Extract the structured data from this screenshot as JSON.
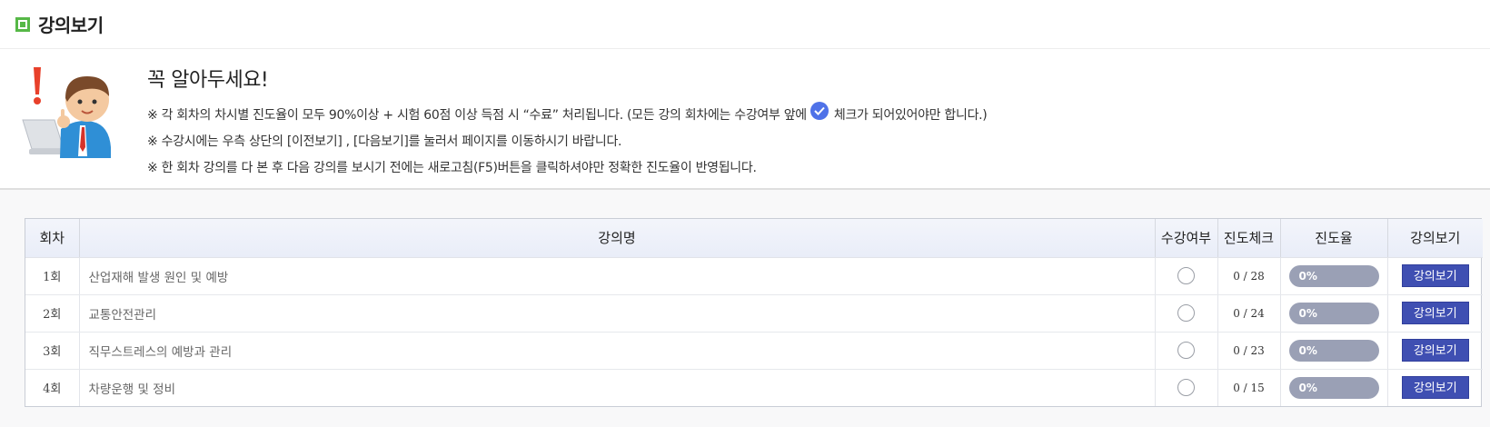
{
  "header": {
    "title": "강의보기",
    "accent_color": "#56b847"
  },
  "notice": {
    "title": "꼭 알아두세요!",
    "line1_before": "※ 각 회차의 차시별 진도율이 모두 90%이상 + 시험 60점 이상 득점 시 “수료” 처리됩니다. (모든 강의 회차에는 수강여부 앞에",
    "line1_after": "체크가 되어있어야만 합니다.)",
    "line2": "※ 수강시에는 우측 상단의 [이전보기] , [다음보기]를 눌러서 페이지를 이동하시기 바랍니다.",
    "line3": "※ 한 회차 강의를 다 본 후 다음 강의를 보시기 전에는 새로고침(F5)버튼을 클릭하셔야만 정확한 진도율이 반영됩니다.",
    "check_icon": "check-circle-icon",
    "check_color": "#4f72e8"
  },
  "table": {
    "headers": {
      "round": "회차",
      "name": "강의명",
      "attend": "수강여부",
      "check": "진도체크",
      "progress": "진도율",
      "view": "강의보기"
    },
    "rows": [
      {
        "round": "1회",
        "name": "산업재해 발생 원인 및 예방",
        "attended": false,
        "check": "0 / 28",
        "progress": 0,
        "progress_label": "0%",
        "button": "강의보기"
      },
      {
        "round": "2회",
        "name": "교통안전관리",
        "attended": false,
        "check": "0 / 24",
        "progress": 0,
        "progress_label": "0%",
        "button": "강의보기"
      },
      {
        "round": "3회",
        "name": "직무스트레스의 예방과 관리",
        "attended": false,
        "check": "0 / 23",
        "progress": 0,
        "progress_label": "0%",
        "button": "강의보기"
      },
      {
        "round": "4회",
        "name": "차량운행 및 정비",
        "attended": false,
        "check": "0 / 15",
        "progress": 0,
        "progress_label": "0%",
        "button": "강의보기"
      }
    ]
  }
}
